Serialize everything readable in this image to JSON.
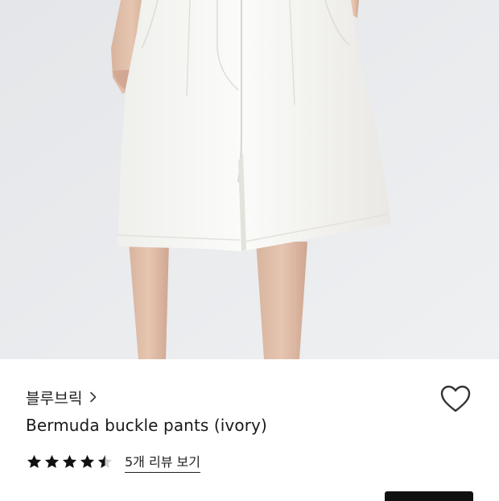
{
  "product": {
    "image_alt_icon": "product-photo",
    "brand": "블루브릭",
    "title": "Bermuda buckle pants (ivory)",
    "rating": 4.5,
    "rating_max": 5,
    "reviews_link": "5개 리뷰 보기"
  },
  "icons": {
    "brand_chevron": "chevron-right-icon",
    "wishlist": "heart-outline-icon",
    "star": "star-icon"
  },
  "colors": {
    "background": "#ffffff",
    "photo_bg": "#e9eaec",
    "text": "#111111",
    "star": "#111111",
    "star_empty": "#d0d0d0",
    "button": "#111111"
  }
}
